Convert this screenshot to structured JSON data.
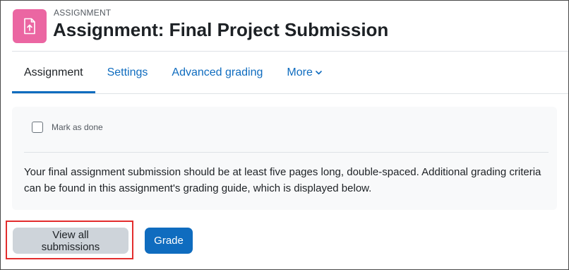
{
  "header": {
    "pretitle": "ASSIGNMENT",
    "title": "Assignment: Final Project Submission",
    "icon": "assignment-upload-icon",
    "icon_color": "#eb66a2"
  },
  "tabs": [
    {
      "label": "Assignment",
      "active": true
    },
    {
      "label": "Settings",
      "active": false
    },
    {
      "label": "Advanced grading",
      "active": false
    },
    {
      "label": "More",
      "active": false,
      "icon": "chevron-down-icon"
    }
  ],
  "completion": {
    "label": "Mark as done",
    "checked": false
  },
  "description": "Your final assignment submission should be at least five pages long, double-spaced. Additional grading criteria can be found in this assignment's grading guide, which is displayed below.",
  "actions": {
    "view_all_label": "View all submissions",
    "grade_label": "Grade"
  },
  "colors": {
    "accent": "#0f6cbf",
    "highlight": "#e32d2d",
    "panel_bg": "#f8f9fa",
    "secondary_button": "#ced4da"
  }
}
